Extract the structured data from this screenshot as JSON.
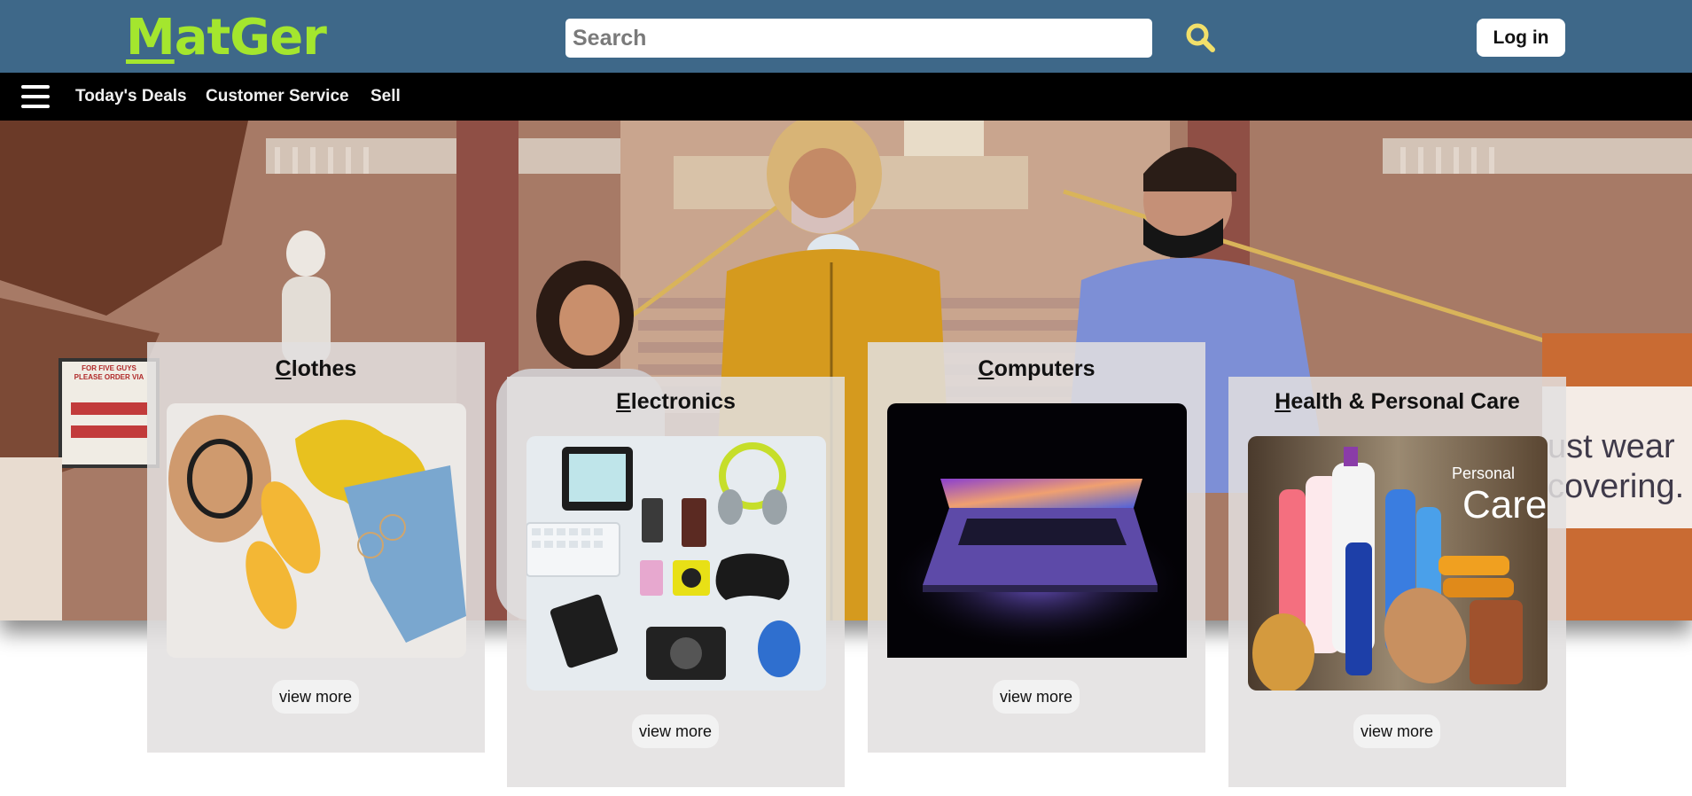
{
  "header": {
    "logo": {
      "first_letter": "M",
      "rest": "atGer"
    },
    "search": {
      "placeholder": "Search",
      "value": ""
    },
    "login_label": "Log in"
  },
  "nav": {
    "items": [
      "Today's Deals",
      "Customer Service",
      "Sell"
    ]
  },
  "categories": [
    {
      "title_first": "C",
      "title_rest": "lothes",
      "button": "view more",
      "image": "clothes-flatlay"
    },
    {
      "title_first": "E",
      "title_rest": "lectronics",
      "button": "view more",
      "image": "electronics-flatlay"
    },
    {
      "title_first": "C",
      "title_rest": "omputers",
      "button": "view more",
      "image": "laptop"
    },
    {
      "title_first": "H",
      "title_rest": "ealth & Personal Care",
      "button": "view more",
      "image": "personal-care-products"
    }
  ],
  "hero_signage": {
    "sign_line_1": "FOR FIVE GUYS",
    "sign_line_2": "PLEASE ORDER VIA",
    "wall_sign_1": "ust wear",
    "wall_sign_2": "covering."
  },
  "personal_care_logo": {
    "line1": "Personal",
    "line2": "Care"
  },
  "colors": {
    "header_bg": "#3e6889",
    "logo": "#a4e62e",
    "nav_bg": "#000000",
    "card_bg": "#e2dfdf",
    "search_icon": "#f2e06a"
  }
}
